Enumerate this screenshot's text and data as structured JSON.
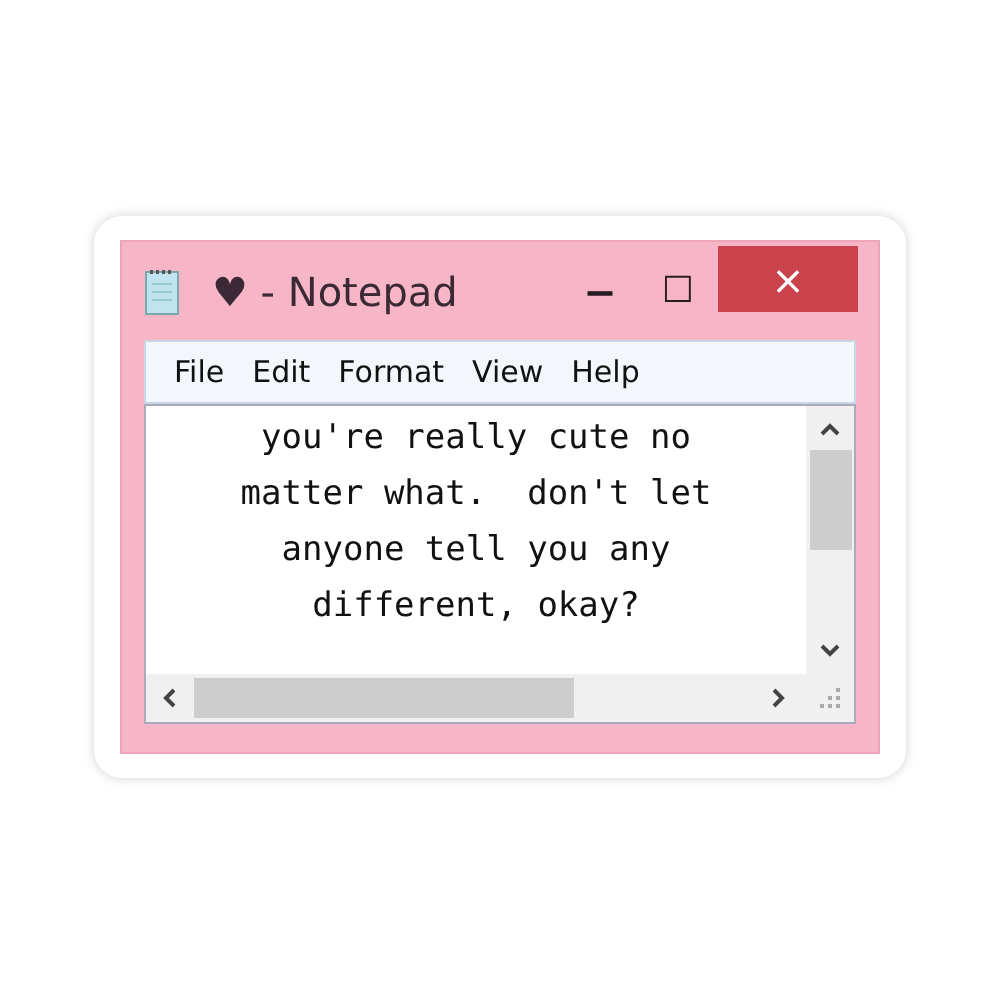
{
  "window": {
    "title": "♥ - Notepad",
    "controls": [
      "−",
      "☐",
      "×"
    ]
  },
  "menu": [
    {
      "label": "File"
    },
    {
      "label": "Edit"
    },
    {
      "label": "Format"
    },
    {
      "label": "View"
    },
    {
      "label": "Help"
    }
  ],
  "document": {
    "lines": [
      "you're really cute no",
      "matter what.  don't let",
      "anyone tell you any",
      "different, okay?"
    ]
  }
}
